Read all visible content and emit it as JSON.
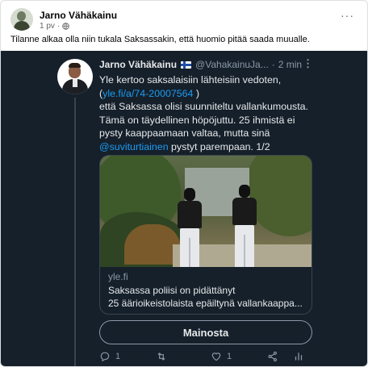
{
  "post": {
    "author": "Jarno Vähäkainu",
    "time": "1 pv",
    "text": "Tilanne alkaa olla niin tukala Saksassakin, että huomio pitää saada muualle.",
    "more_label": "···"
  },
  "tweet": {
    "name": "Jarno Vähäkainu",
    "handle": "@VahakainuJa...",
    "time": "2 min",
    "more_label": "⋮",
    "body_lines": {
      "l1": "Yle kertoo saksalaisiin lähteisiin vedoten,",
      "l2_link": "yle.fi/a/74-20007564",
      "l3": "että Saksassa olisi suunniteltu vallankumousta.",
      "l4": "Tämä on täydellinen höpöjuttu. 25 ihmistä ei",
      "l5": "pysty kaappaamaan valtaa, mutta sinä",
      "l6_mention": "@suviturtiainen",
      "l6_rest": " pystyt parempaan. 1/2"
    },
    "card": {
      "domain": "yle.fi",
      "title_line1": "Saksassa poliisi on pidättänyt",
      "title_line2": "25 äärioikeistolaista epäiltynä vallankaappa..."
    },
    "ad_button": "Mainosta",
    "actions": {
      "reply_count": "1",
      "retweet_count": "",
      "like_count": "1"
    }
  },
  "colors": {
    "tweet_bg": "#15202b",
    "link": "#1d9bf0",
    "muted": "#8b98a5"
  }
}
